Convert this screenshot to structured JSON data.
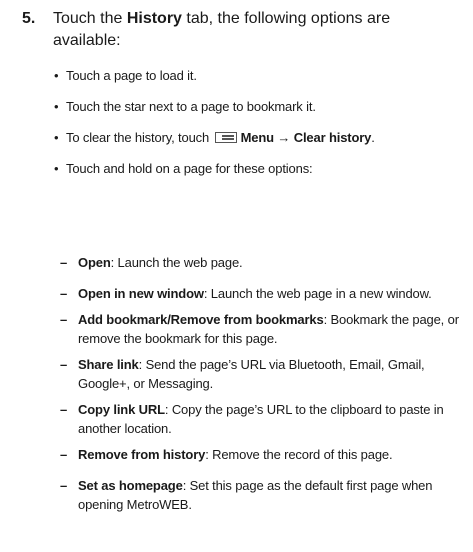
{
  "step": {
    "number": "5.",
    "text_before": "Touch the ",
    "tab_name": "History",
    "text_after": " tab, the following options are available:"
  },
  "bullets": {
    "symbol": "•",
    "items": [
      "Touch a page to load it.",
      "Touch the star next to a page to bookmark it."
    ],
    "clear_history": {
      "prefix": "To clear the history, touch ",
      "icon": "menu-icon",
      "menu_label": "Menu",
      "arrow": "→",
      "action_label": "Clear history",
      "suffix": "."
    },
    "hold_intro": "Touch and hold on a page for these options:"
  },
  "options": {
    "dash": "–",
    "items": [
      {
        "label": "Open",
        "description": ": Launch the web page."
      },
      {
        "label": "Open in new window",
        "description": ": Launch the web page in a new window."
      },
      {
        "label": "Add bookmark/Remove from bookmarks",
        "description": ": Bookmark the page, or remove the bookmark for this page."
      },
      {
        "label": "Share link",
        "description": ": Send the page’s URL via Bluetooth, Email, Gmail, Google+, or Messaging."
      },
      {
        "label": "Copy link URL",
        "description": ": Copy the page’s URL to the clipboard to paste in another location."
      },
      {
        "label": "Remove from history",
        "description": ": Remove the record of this page."
      },
      {
        "label": "Set as homepage",
        "description": ": Set this page as the default first page when opening MetroWEB."
      }
    ]
  }
}
